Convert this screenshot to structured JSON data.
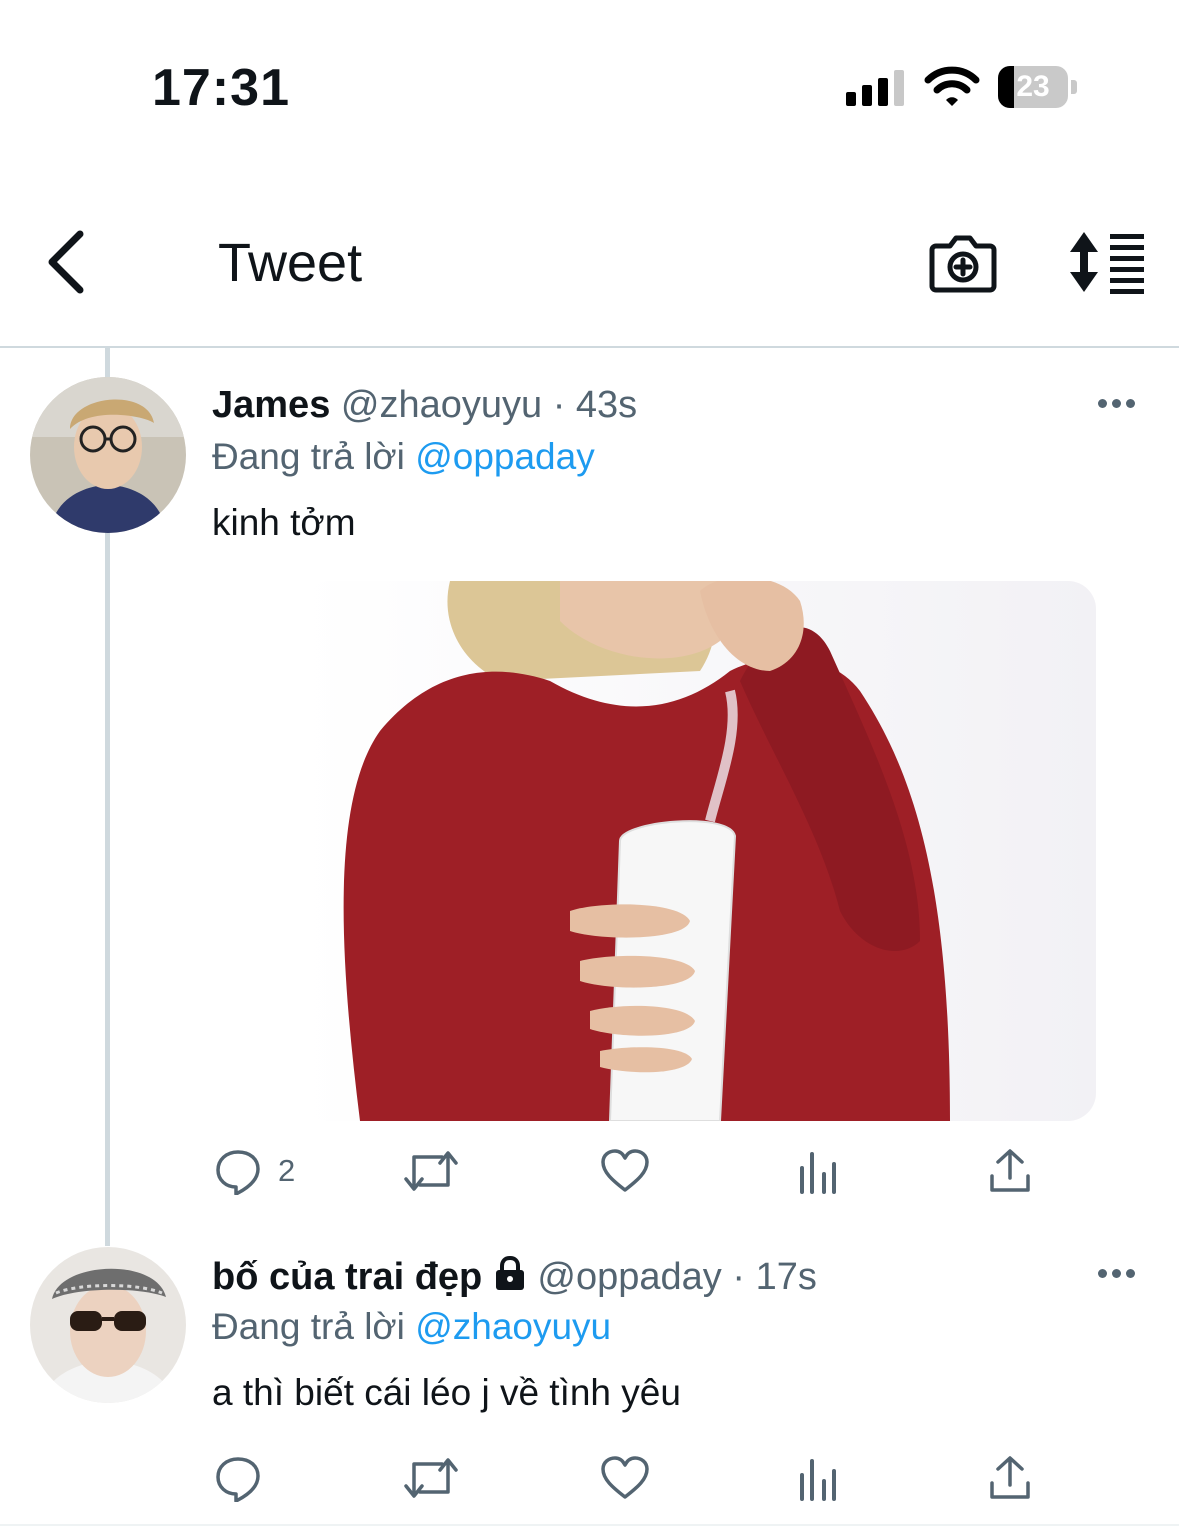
{
  "status_bar": {
    "time": "17:31",
    "battery_level": "23",
    "signal_bars_active": 3,
    "signal_bars_total": 4
  },
  "header": {
    "title": "Tweet",
    "icons": [
      "back-chevron-icon",
      "camera-plus-icon",
      "sort-icon"
    ]
  },
  "tweets": [
    {
      "name": "James",
      "handle": "@zhaoyuyu",
      "time": "· 43s",
      "reply_prefix": "Đang trả lời",
      "reply_to": "@oppaday",
      "text": "kinh tởm",
      "has_media": true,
      "locked": false,
      "reply_count": "2"
    },
    {
      "name": "bố của trai đẹp",
      "handle": "@oppaday",
      "time": "· 17s",
      "reply_prefix": "Đang trả lời",
      "reply_to": "@zhaoyuyu",
      "text": "a thì biết cái léo j về tình yêu",
      "has_media": false,
      "locked": true,
      "reply_count": ""
    }
  ],
  "colors": {
    "accent": "#1d9bf0",
    "secondary_text": "#536471",
    "primary_text": "#0f1419",
    "divider": "#cfd9de"
  }
}
